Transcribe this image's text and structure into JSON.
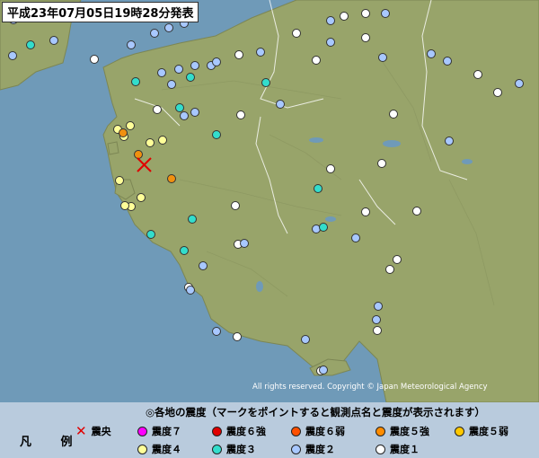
{
  "title": "平成23年07月05日19時28分発表",
  "copyright": "All rights reserved. Copyright © Japan Meteorological Agency",
  "legend": {
    "label": "凡 例",
    "note": "◎各地の震度（マークをポイントすると観測点名と震度が表示されます）",
    "epicenter_label": "震央",
    "items": [
      {
        "label": "震度７",
        "color": "#ff00ff"
      },
      {
        "label": "震度６強",
        "color": "#e00000"
      },
      {
        "label": "震度６弱",
        "color": "#ff5000"
      },
      {
        "label": "震度５強",
        "color": "#ff8c00"
      },
      {
        "label": "震度５弱",
        "color": "#ffc800"
      },
      {
        "label": "震度４",
        "color": "#ffff99"
      },
      {
        "label": "震度３",
        "color": "#33ddcc"
      },
      {
        "label": "震度２",
        "color": "#a8c8ff"
      },
      {
        "label": "震度１",
        "color": "#ffffff"
      }
    ]
  },
  "colors": {
    "sea": "#6f9ab8",
    "land": "#98a46a",
    "epicenter": "#e00000",
    "intensity_5_weak_dot": "#f09010",
    "intensity_4": "#ffff99",
    "intensity_3": "#33ddcc",
    "intensity_2": "#a8c8ff",
    "intensity_1": "#ffffff"
  }
}
